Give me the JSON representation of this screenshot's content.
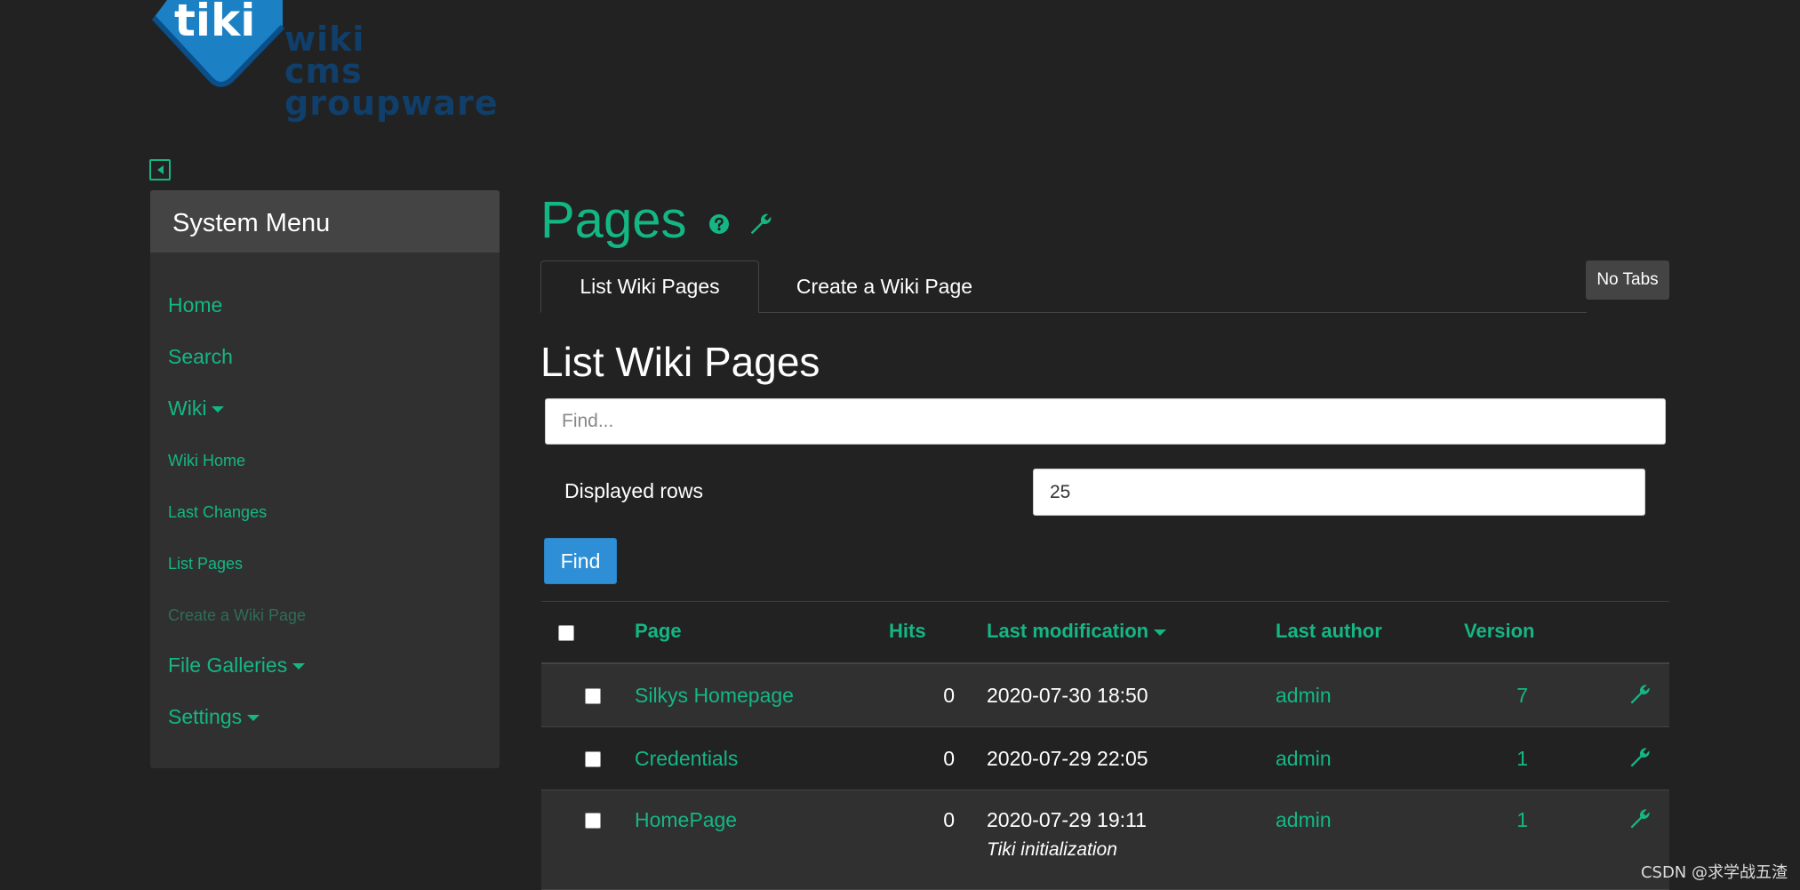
{
  "logo": {
    "text": "tiki",
    "lines": [
      "wiki",
      "cms",
      "groupware"
    ]
  },
  "sidebar": {
    "title": "System Menu",
    "items": [
      {
        "label": "Home"
      },
      {
        "label": "Search"
      },
      {
        "label": "Wiki"
      },
      {
        "label": "Wiki Home"
      },
      {
        "label": "Last Changes"
      },
      {
        "label": "List Pages"
      },
      {
        "label": "Create a Wiki Page"
      },
      {
        "label": "File Galleries"
      },
      {
        "label": "Settings"
      }
    ]
  },
  "header": {
    "title": "Pages"
  },
  "tabs": [
    {
      "label": "List Wiki Pages",
      "active": true
    },
    {
      "label": "Create a Wiki Page",
      "active": false
    }
  ],
  "no_tabs_label": "No Tabs",
  "section_title": "List Wiki Pages",
  "search": {
    "placeholder": "Find...",
    "rows_label": "Displayed rows",
    "rows_value": "25",
    "button_label": "Find"
  },
  "table": {
    "columns": [
      "Page",
      "Hits",
      "Last modification",
      "Last author",
      "Version"
    ],
    "rows": [
      {
        "page": "Silkys Homepage",
        "hits": "0",
        "modified": "2020-07-30 18:50",
        "author": "admin",
        "version": "7",
        "comment": ""
      },
      {
        "page": "Credentials",
        "hits": "0",
        "modified": "2020-07-29 22:05",
        "author": "admin",
        "version": "1",
        "comment": ""
      },
      {
        "page": "HomePage",
        "hits": "0",
        "modified": "2020-07-29 19:11",
        "author": "admin",
        "version": "1",
        "comment": "Tiki initialization"
      }
    ]
  },
  "watermark": "CSDN @求学战五渣",
  "colors": {
    "accent": "#14b784",
    "background": "#222222",
    "sidebar": "#303030",
    "button": "#2e8fd6"
  }
}
